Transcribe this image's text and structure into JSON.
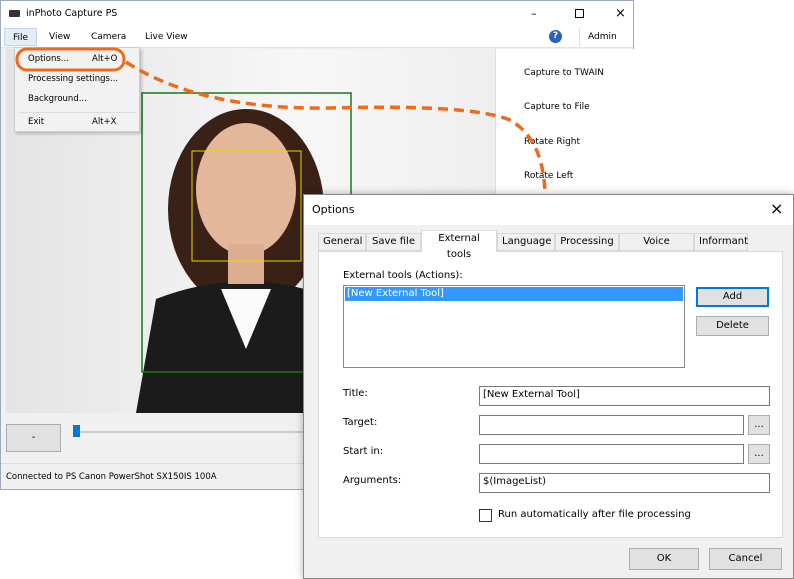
{
  "app": {
    "title": "inPhoto Capture PS",
    "menu": [
      "File",
      "View",
      "Camera",
      "Live View"
    ],
    "admin": "Admin",
    "file_menu": [
      {
        "label": "Options...",
        "shortcut": "Alt+O"
      },
      {
        "label": "Processing settings...",
        "shortcut": ""
      },
      {
        "label": "Background...",
        "shortcut": ""
      },
      {
        "label": "Exit",
        "shortcut": "Alt+X"
      }
    ],
    "actions": [
      "Capture to TWAIN",
      "Capture to File",
      "Rotate Right",
      "Rotate Left"
    ],
    "minus_button": "-",
    "status": "Connected to PS Canon PowerShot SX150IS 100A"
  },
  "dialog": {
    "title": "Options",
    "tabs": [
      "General",
      "Save file",
      "External tools",
      "Language",
      "Processing",
      "Voice Control",
      "Informant"
    ],
    "active_tab": "External tools",
    "list_label": "External tools (Actions):",
    "list_items": [
      "[New External Tool]"
    ],
    "add": "Add",
    "delete": "Delete",
    "title_label": "Title:",
    "title_value": "[New External Tool]",
    "target_label": "Target:",
    "target_value": "",
    "startin_label": "Start in:",
    "startin_value": "",
    "arguments_label": "Arguments:",
    "arguments_value": "$(ImageList)",
    "browse": "...",
    "run_auto": "Run automatically after file processing",
    "run_auto_checked": false,
    "ok": "OK",
    "cancel": "Cancel"
  },
  "colors": {
    "highlight": "#ec6b1d",
    "selection": "#3399ff",
    "face_box": "#e8d800",
    "frame_box": "#1a7a1a"
  }
}
